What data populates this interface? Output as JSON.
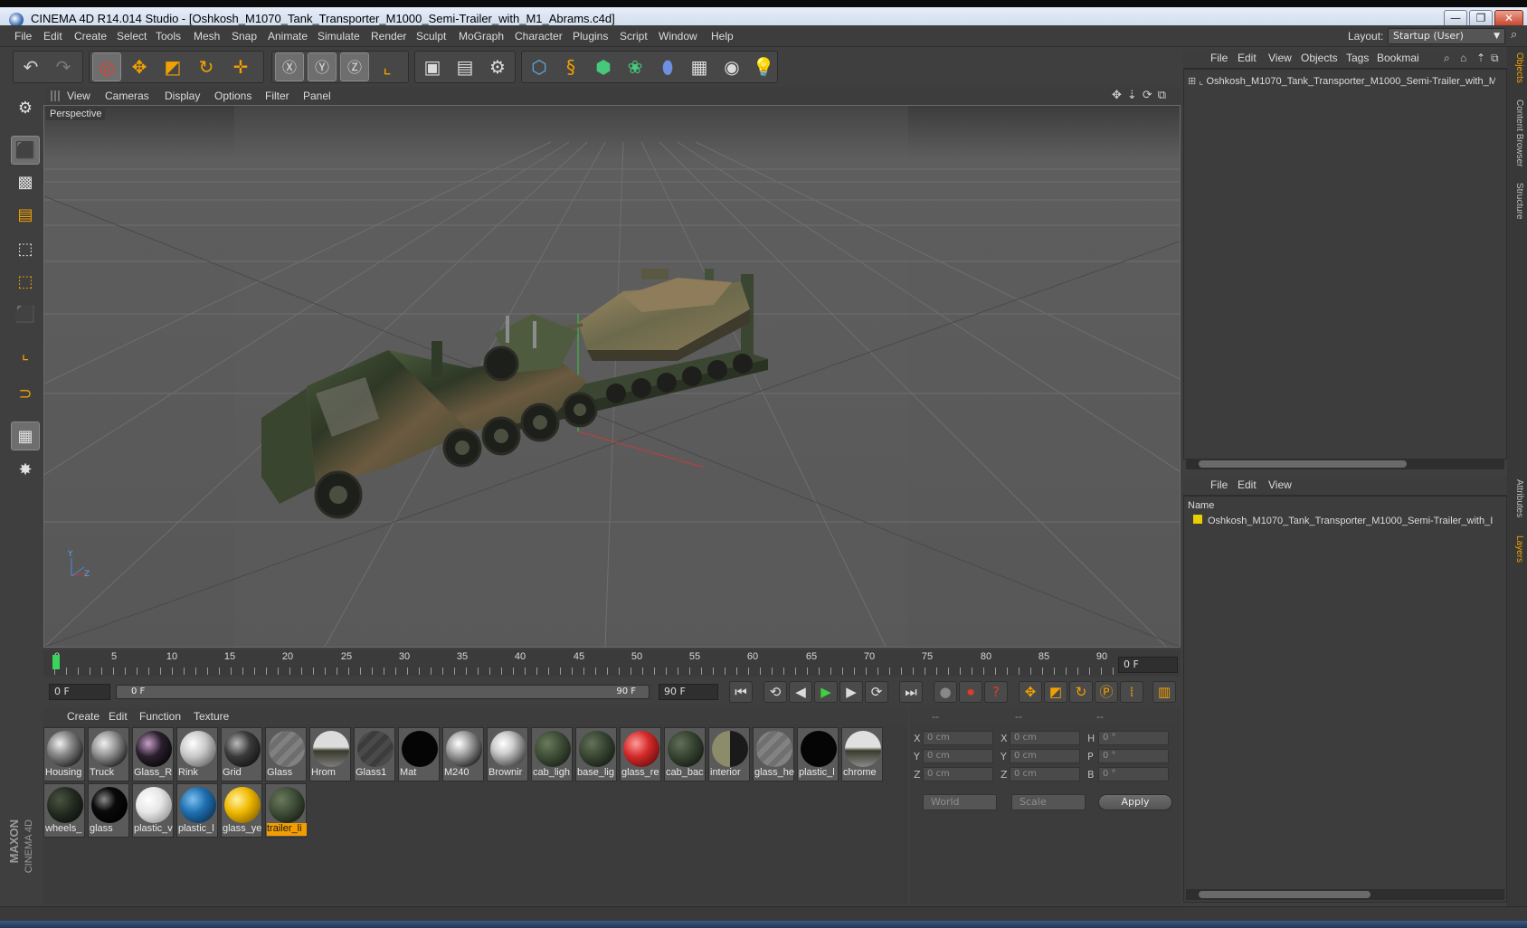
{
  "window": {
    "title": "CINEMA 4D R14.014 Studio - [Oshkosh_M1070_Tank_Transporter_M1000_Semi-Trailer_with_M1_Abrams.c4d]",
    "minimize": "—",
    "maximize": "❐",
    "close": "✕"
  },
  "menubar": {
    "items": [
      "File",
      "Edit",
      "Create",
      "Select",
      "Tools",
      "Mesh",
      "Snap",
      "Animate",
      "Simulate",
      "Render",
      "Sculpt",
      "MoGraph",
      "Character",
      "Plugins",
      "Script",
      "Window",
      "Help"
    ],
    "layout_label": "Layout:",
    "layout_value": "Startup (User)"
  },
  "viewport": {
    "menu": [
      "View",
      "Cameras",
      "Display",
      "Options",
      "Filter",
      "Panel"
    ],
    "label": "Perspective"
  },
  "timeline": {
    "ticks": [
      "0",
      "5",
      "10",
      "15",
      "20",
      "25",
      "30",
      "35",
      "40",
      "45",
      "50",
      "55",
      "60",
      "65",
      "70",
      "75",
      "80",
      "85",
      "90"
    ],
    "end_field": "0 F",
    "current_frame": "0 F",
    "range_start": "0 F",
    "range_end": "90 F",
    "max_frame": "90 F"
  },
  "materials": {
    "menu": [
      "Create",
      "Edit",
      "Function",
      "Texture"
    ],
    "items": [
      {
        "label": "Housing",
        "color": "#8a8a8a"
      },
      {
        "label": "Truck",
        "color": "#9a9a9a"
      },
      {
        "label": "Glass_R",
        "color": "#2a1f2e"
      },
      {
        "label": "Rink",
        "color": "#c8c8c8"
      },
      {
        "label": "Grid",
        "color": "#3a3a3a"
      },
      {
        "label": "Glass",
        "color": "#6e6e6e"
      },
      {
        "label": "Hrom",
        "color": "#7c7c7c"
      },
      {
        "label": "Glass1",
        "color": "#3c3c3c"
      },
      {
        "label": "Mat",
        "color": "#050505"
      },
      {
        "label": "M240",
        "color": "#b0b0b0"
      },
      {
        "label": "Brownir",
        "color": "#d0d0d0"
      },
      {
        "label": "cab_ligh",
        "color": "#3a4a34"
      },
      {
        "label": "base_lig",
        "color": "#344230"
      },
      {
        "label": "glass_re",
        "color": "#d42a2a"
      },
      {
        "label": "cab_bac",
        "color": "#33402f"
      },
      {
        "label": "interior",
        "color": "#8c8c6a"
      },
      {
        "label": "glass_he",
        "color": "#707070"
      },
      {
        "label": "plastic_l",
        "color": "#050505"
      },
      {
        "label": "chrome",
        "color": "#8a8a8a"
      },
      {
        "label": "wheels_",
        "color": "#222a20"
      },
      {
        "label": "glass",
        "color": "#0a0a0a"
      },
      {
        "label": "plastic_v",
        "color": "#e6e6e6"
      },
      {
        "label": "plastic_l",
        "color": "#1f6fb0"
      },
      {
        "label": "glass_ye",
        "color": "#f0b800"
      },
      {
        "label": "trailer_li",
        "color": "#3b4a35"
      }
    ],
    "selected_index": 24
  },
  "coordinates": {
    "menu": [
      "--",
      "--",
      "--"
    ],
    "rows": [
      {
        "a": "X",
        "av": "0 cm",
        "b": "X",
        "bv": "0 cm",
        "c": "H",
        "cv": "0 °"
      },
      {
        "a": "Y",
        "av": "0 cm",
        "b": "Y",
        "bv": "0 cm",
        "c": "P",
        "cv": "0 °"
      },
      {
        "a": "Z",
        "av": "0 cm",
        "b": "Z",
        "bv": "0 cm",
        "c": "B",
        "cv": "0 °"
      }
    ],
    "space": "World",
    "mode": "Scale",
    "apply": "Apply"
  },
  "objects": {
    "menu": [
      "File",
      "Edit",
      "View",
      "Objects",
      "Tags",
      "Bookmai"
    ],
    "root": "Oshkosh_M1070_Tank_Transporter_M1000_Semi-Trailer_with_M"
  },
  "layers": {
    "menu": [
      "File",
      "Edit",
      "View"
    ],
    "header": "Name",
    "row": "Oshkosh_M1070_Tank_Transporter_M1000_Semi-Trailer_with_I"
  },
  "side_tabs": [
    "Objects",
    "Content Browser",
    "Structure",
    "Attributes",
    "Layers"
  ],
  "logo": {
    "line1": "MAXON",
    "line2": "CINEMA 4D"
  }
}
